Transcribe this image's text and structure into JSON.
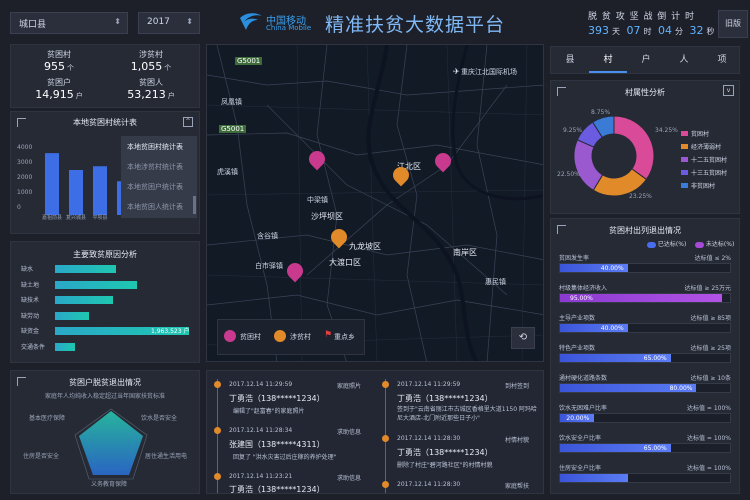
{
  "header": {
    "county_select": "城口县",
    "year_select": "2017",
    "logo_cn": "中国移动",
    "logo_en": "China Mobile",
    "title": "精准扶贫大数据平台",
    "countdown_title": "脱 贫 攻 坚 战 倒 计 时",
    "countdown": {
      "days": "393",
      "days_unit": "天",
      "hours": "07",
      "hours_unit": "时",
      "minutes": "04",
      "minutes_unit": "分",
      "seconds": "32",
      "seconds_unit": "秒"
    },
    "old_version": "旧版"
  },
  "stats": [
    {
      "label": "贫困村",
      "value": "955",
      "unit": "个"
    },
    {
      "label": "涉贫村",
      "value": "1,055",
      "unit": "个"
    },
    {
      "label": "贫困户",
      "value": "14,915",
      "unit": "户"
    },
    {
      "label": "贫困人",
      "value": "53,213",
      "unit": "户"
    }
  ],
  "local_stats": {
    "title": "本地贫困村统计表",
    "y_ticks": [
      "4000",
      "3000",
      "2000",
      "1000",
      "0"
    ],
    "dropdown": [
      "本地贫困村统计表",
      "本地涉贫村统计表",
      "本地贫困户统计表",
      "本地贫困人统计表"
    ],
    "chart_data": {
      "type": "bar",
      "categories": [
        "嘉祖前县",
        "复兴城县",
        "平坝县",
        "",
        "",
        ""
      ],
      "values": [
        3300,
        2400,
        2600,
        1800,
        2200,
        1300
      ],
      "ylim": [
        0,
        4000
      ]
    }
  },
  "causes": {
    "title": "主要致贫原因分析",
    "chart_data": {
      "type": "bar",
      "categories": [
        "缺水",
        "缺土地",
        "缺技术",
        "缺劳动",
        "缺资金",
        "交通条件"
      ],
      "values": [
        900000,
        1200000,
        850000,
        500000,
        1963523,
        300000
      ],
      "value_label": "1,963,523 户"
    }
  },
  "exit": {
    "title": "贫困户脱贫退出情况",
    "subtitle": "家庭年人均纯收入稳定超过当年国家扶贫标准",
    "axes": [
      "基本医疗保障",
      "饮水是否安全",
      "住房是否安全",
      "居住通生活用电",
      "义务教育保障"
    ]
  },
  "feed": {
    "left": [
      {
        "time": "2017.12.14 11:29:59",
        "type": "家庭照片",
        "name": "丁勇浩（138*****1234）",
        "text": "编辑了\"赵富春\"的家庭照片"
      },
      {
        "time": "2017.12.14 11:28:34",
        "type": "求助信息",
        "name": "张建国（138*****4311）",
        "text": "回复了 \"洪水灾害过后庄稼的养护处理\""
      },
      {
        "time": "2017.12.14 11:23:21",
        "type": "求助信息",
        "name": "丁勇浩（138*****1234）",
        "text": ""
      }
    ],
    "right": [
      {
        "time": "2017.12.14 11:29:59",
        "type": "到村签到",
        "name": "丁勇浩（138*****1234）",
        "text": "签到于\"云南省丽江市古城区香格里大道1150 阿玛哈尼大酒店-北门附近那些日子小\""
      },
      {
        "time": "2017.12.14 11:28:30",
        "type": "村情村貌",
        "name": "丁勇浩（138*****1234）",
        "text": "删除了村庄\"碧河路社区\"的村情村貌"
      },
      {
        "time": "2017.12.14 11:28:30",
        "type": "家庭帮扶",
        "name": "",
        "text": ""
      }
    ]
  },
  "map": {
    "labels": [
      "G5001",
      "凤凰镇",
      "G5001",
      "虎溪镇",
      "重庆江北国际机场",
      "江北区",
      "沙坪坝区",
      "九龙坡区",
      "大渡口区",
      "南岸区",
      "含谷镇",
      "白市驿镇",
      "惠民镇",
      "中梁镇"
    ],
    "legend": [
      "贫困村",
      "涉贫村",
      "重点乡"
    ]
  },
  "tabs": [
    "县",
    "村",
    "户",
    "人",
    "项"
  ],
  "village_attr": {
    "title": "村属性分析",
    "chart_data": {
      "type": "pie",
      "categories": [
        "贫困村",
        "经济薄弱村",
        "十二五贫困村",
        "十三五贫困村",
        "非贫困村"
      ],
      "values": [
        34.25,
        23.25,
        22.5,
        9.25,
        8.75
      ],
      "colors": [
        "#d94a98",
        "#e08a2a",
        "#9b59d0",
        "#6a5be0",
        "#3a7bd5"
      ],
      "labels": [
        "34.25%",
        "23.25%",
        "22.50%",
        "9.25%",
        "8.75%"
      ]
    }
  },
  "exit_status": {
    "title": "贫困村出列退出情况",
    "legend": [
      "已达标(%)",
      "未达标(%)"
    ],
    "items": [
      {
        "label": "贫困发生率",
        "target": "达标值 ≤ 2%",
        "value": 40,
        "text": "40.00%",
        "met": true
      },
      {
        "label": "村级集体经济收入",
        "target": "达标值 ≥ 25万元",
        "value": 95,
        "text": "95.00%",
        "met": false
      },
      {
        "label": "主导产业项数",
        "target": "达标值 ≥ 85项",
        "value": 40,
        "text": "40.00%",
        "met": true
      },
      {
        "label": "特色产业项数",
        "target": "达标值 ≥ 25项",
        "value": 65,
        "text": "65.00%",
        "met": true
      },
      {
        "label": "通村硬化道路条数",
        "target": "达标值 ≥ 10条",
        "value": 80,
        "text": "80.00%",
        "met": true
      },
      {
        "label": "饮水无困难户比率",
        "target": "达标值 = 100%",
        "value": 20,
        "text": "20.00%",
        "met": true
      },
      {
        "label": "饮水安全户比率",
        "target": "达标值 = 100%",
        "value": 65,
        "text": "65.00%",
        "met": true
      },
      {
        "label": "住房安全户比率",
        "target": "达标值 = 100%",
        "value": 40,
        "text": "",
        "met": true
      }
    ]
  }
}
